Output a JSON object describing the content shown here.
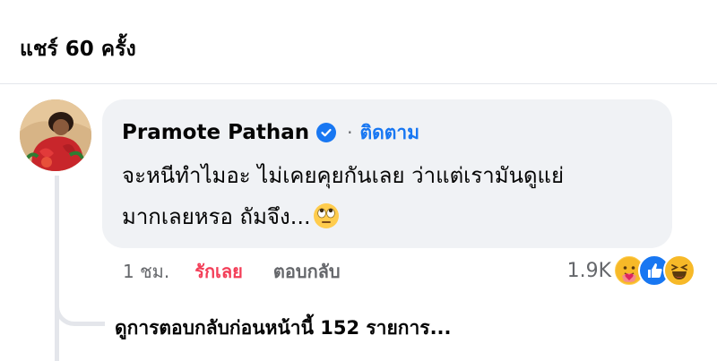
{
  "header": {
    "share_count_text": "แชร์ 60 ครั้ง"
  },
  "comment": {
    "author": "Pramote Pathan",
    "verified_icon": "verified-badge-icon",
    "separator": "·",
    "follow_label": "ติดตาม",
    "text_line1": "จะหนีทำไมอะ ไม่เคยคุยกันเลย ว่าแต่เรามันดูแย่",
    "text_line2": "มากเลยหรอ ถัมจึง...",
    "text_emoji": "face-with-rolling-eyes-emoji",
    "time": "1 ชม.",
    "love_label": "รักเลย",
    "reply_label": "ตอบกลับ",
    "reaction_count": "1.9K",
    "reaction_icons": [
      "care-reaction-icon",
      "like-reaction-icon",
      "haha-reaction-icon"
    ]
  },
  "thread": {
    "view_previous_replies": "ดูการตอบกลับก่อนหน้านี้ 152 รายการ..."
  },
  "colors": {
    "accent_blue": "#1877f2",
    "love_red": "#f33e58",
    "bubble_bg": "#f0f2f5",
    "secondary_text": "#65676b"
  }
}
